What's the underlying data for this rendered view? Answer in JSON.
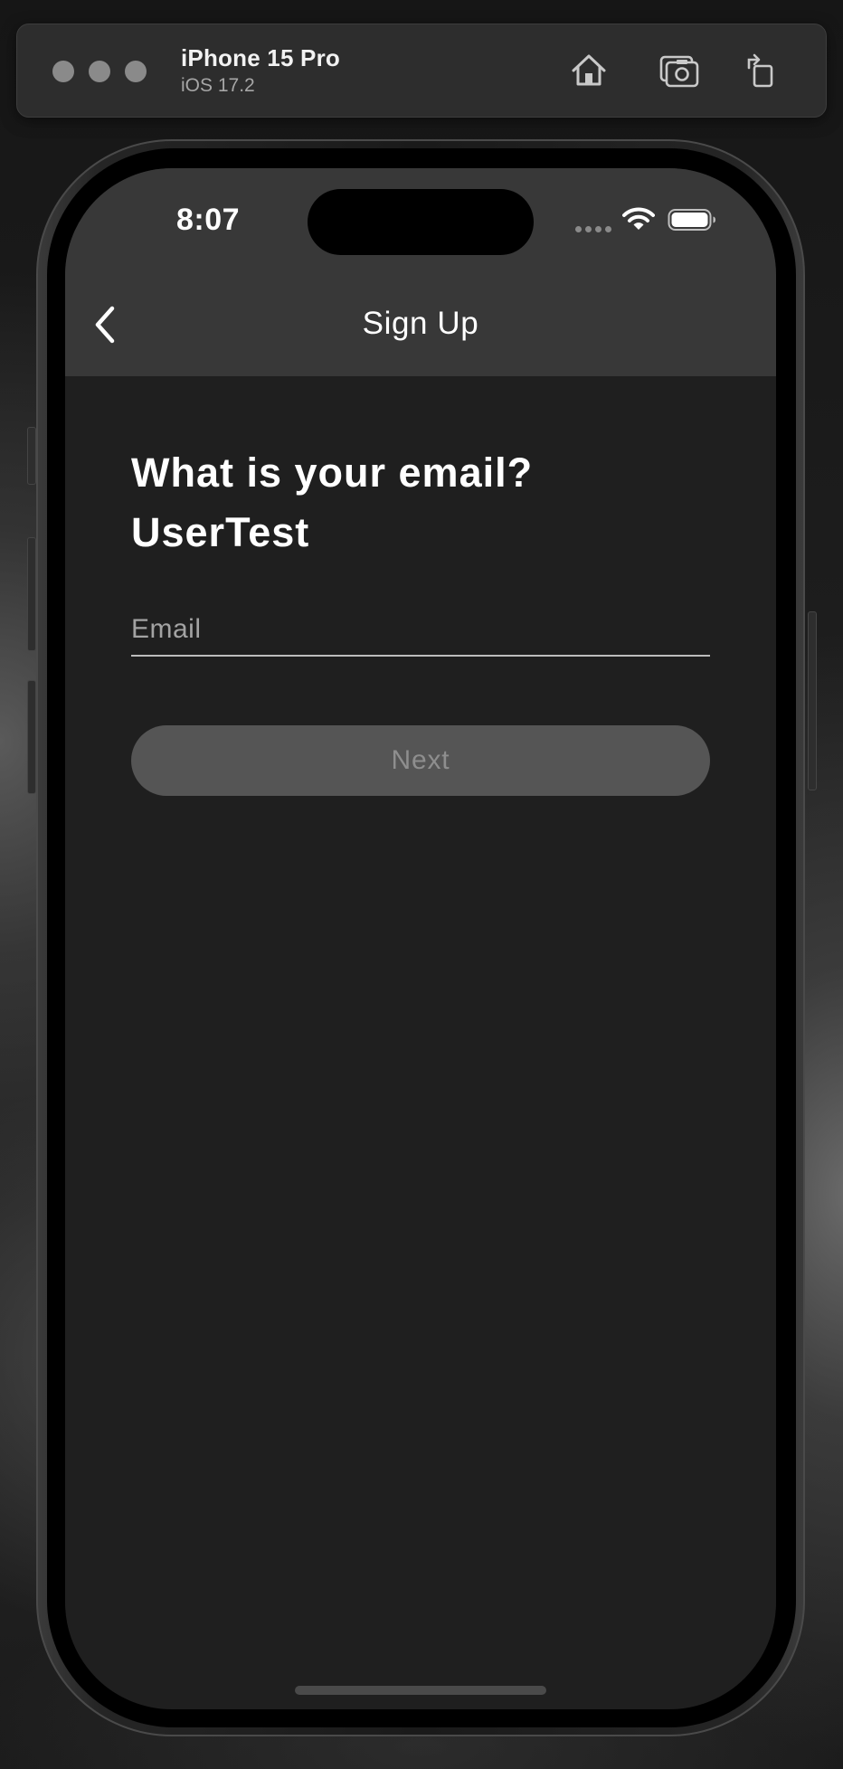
{
  "simulator": {
    "device_name": "iPhone 15 Pro",
    "os_version": "iOS 17.2",
    "toolbar_icons": [
      "home-icon",
      "screenshot-icon",
      "rotate-icon"
    ]
  },
  "status_bar": {
    "time": "8:07",
    "icons": [
      "cellular-signal-icon",
      "wifi-icon",
      "battery-icon"
    ]
  },
  "nav": {
    "back_icon": "chevron-left-icon",
    "title": "Sign Up"
  },
  "form": {
    "headline": "What is your email?\nUserTest",
    "email_placeholder": "Email",
    "email_value": "",
    "next_label": "Next"
  },
  "colors": {
    "screen_background": "#1f1f1f",
    "navbar_background": "#383838",
    "button_disabled": "#555555",
    "button_text_disabled": "#8e8e8e"
  }
}
